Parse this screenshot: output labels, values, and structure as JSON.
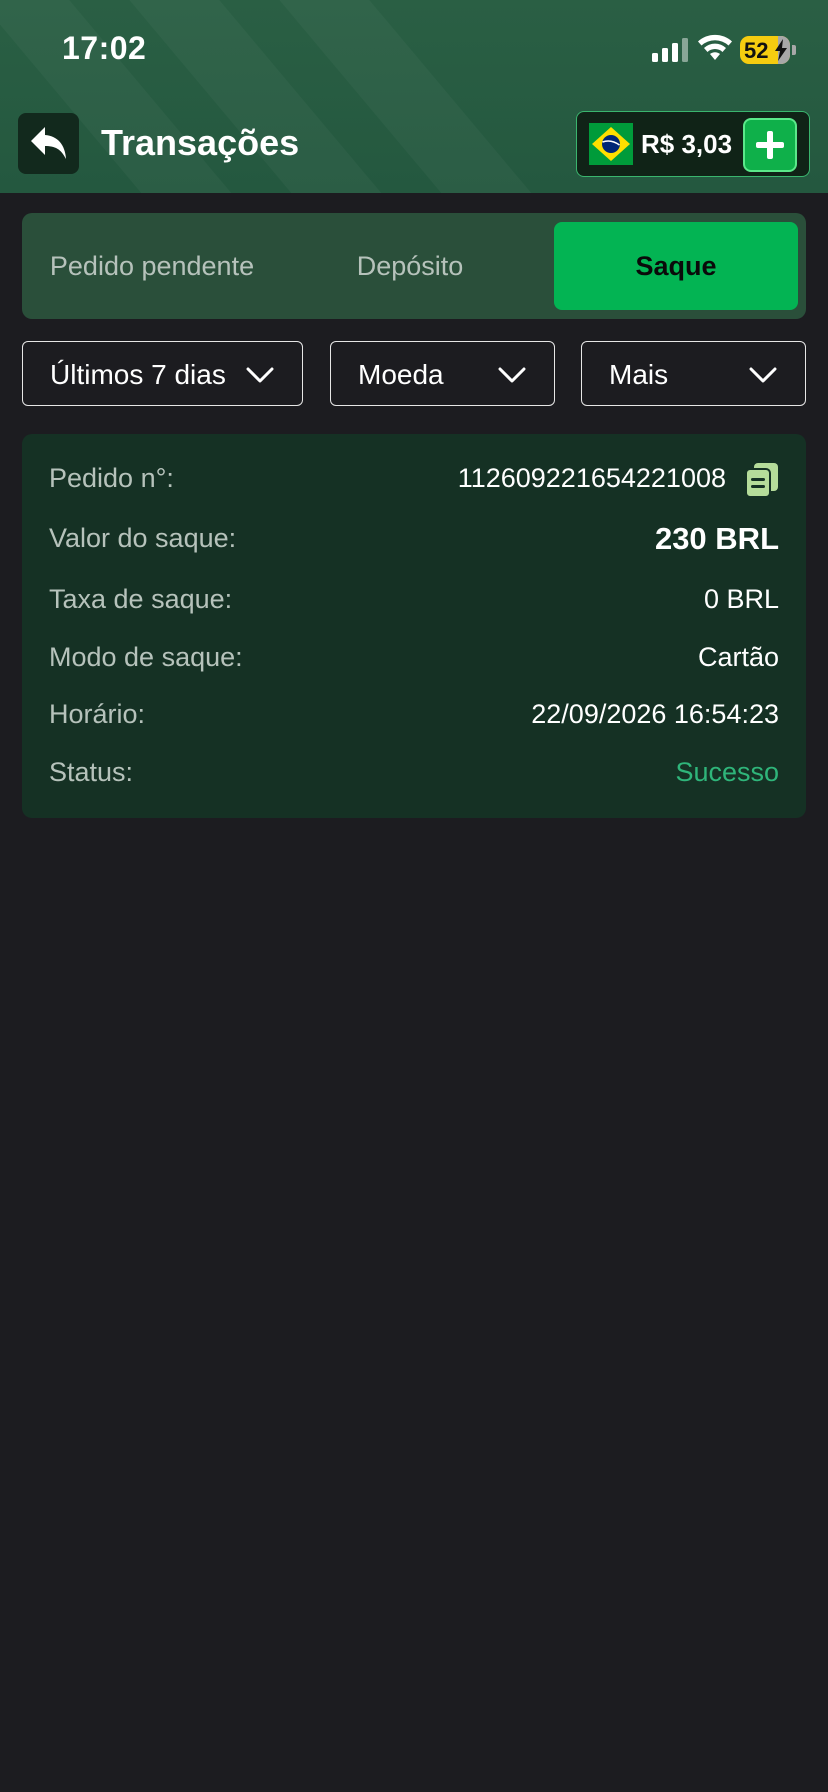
{
  "status_bar": {
    "time": "17:02",
    "battery_level": "52",
    "icons": [
      "signal-icon",
      "wifi-icon",
      "battery-icon"
    ]
  },
  "header": {
    "title": "Transações",
    "back_icon": "reply-arrow-icon",
    "balance": "R$ 3,03",
    "flag_icon": "brazil-flag-icon",
    "add_icon": "plus-icon"
  },
  "tabs": [
    {
      "label": "Pedido pendente",
      "active": false
    },
    {
      "label": "Depósito",
      "active": false
    },
    {
      "label": "Saque",
      "active": true
    }
  ],
  "filters": {
    "period": "Últimos 7 dias",
    "currency": "Moeda",
    "more": "Mais"
  },
  "transaction": {
    "order_label": "Pedido n°:",
    "order_value": "112609221654221008",
    "amount_label": "Valor do saque:",
    "amount_value": "230 BRL",
    "fee_label": "Taxa de saque:",
    "fee_value": "0 BRL",
    "mode_label": "Modo de saque:",
    "mode_value": "Cartão",
    "time_label": "Horário:",
    "time_value": "22/09/2026 16:54:23",
    "status_label": "Status:",
    "status_value": "Sucesso"
  },
  "colors": {
    "header_bg": "#2a5f44",
    "accent_green": "#03b453",
    "success_text": "#2fb57a",
    "page_bg": "#1c1c20",
    "card_bg": "#153124"
  }
}
